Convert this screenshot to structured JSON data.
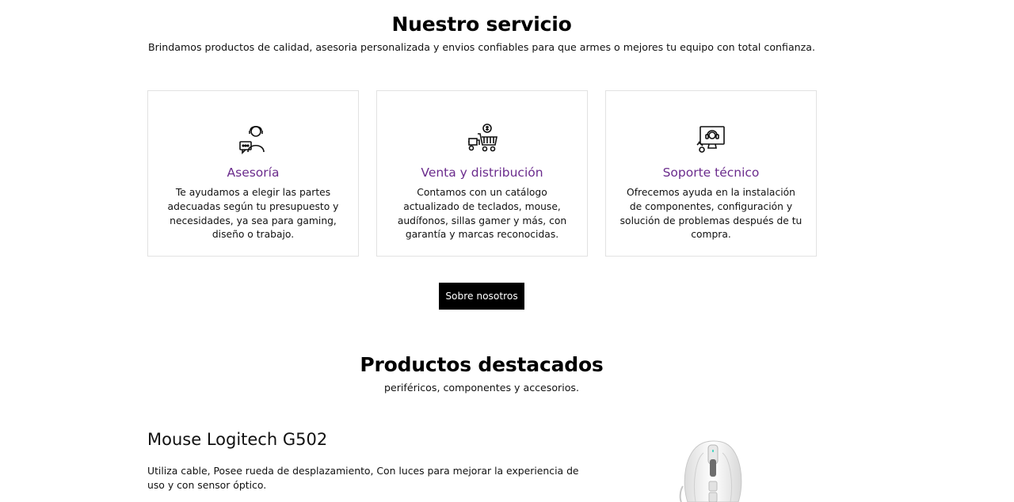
{
  "service": {
    "title": "Nuestro servicio",
    "subtitle": "Brindamos productos de calidad, asesoria personalizada y envios confiables para que armes o mejores tu equipo con total confianza.",
    "cards": [
      {
        "icon": "support-agent-icon",
        "title": "Asesoría",
        "text": "Te ayudamos a elegir las partes adecuadas según tu presupuesto y necesidades, ya sea para gaming, diseño o trabajo."
      },
      {
        "icon": "delivery-cart-icon",
        "title": "Venta y distribución",
        "text": "Contamos con un catálogo actualizado de teclados, mouse, audífonos, sillas gamer y más, con garantía y marcas reconocidas."
      },
      {
        "icon": "tech-support-icon",
        "title": "Soporte técnico",
        "text": "Ofrecemos ayuda en la instalación de componentes, configuración y solución de problemas después de tu compra."
      }
    ],
    "button_label": "Sobre nosotros"
  },
  "featured": {
    "title": "Productos destacados",
    "subtitle": "periféricos, componentes y accesorios.",
    "product": {
      "name": "Mouse Logitech G502",
      "description": "Utiliza cable, Posee rueda de desplazamiento, Con luces para mejorar la experiencia de uso y con sensor óptico.",
      "image": "white-gaming-mouse-image"
    }
  },
  "colors": {
    "accent": "#6a2b8c",
    "button_bg": "#000000"
  }
}
